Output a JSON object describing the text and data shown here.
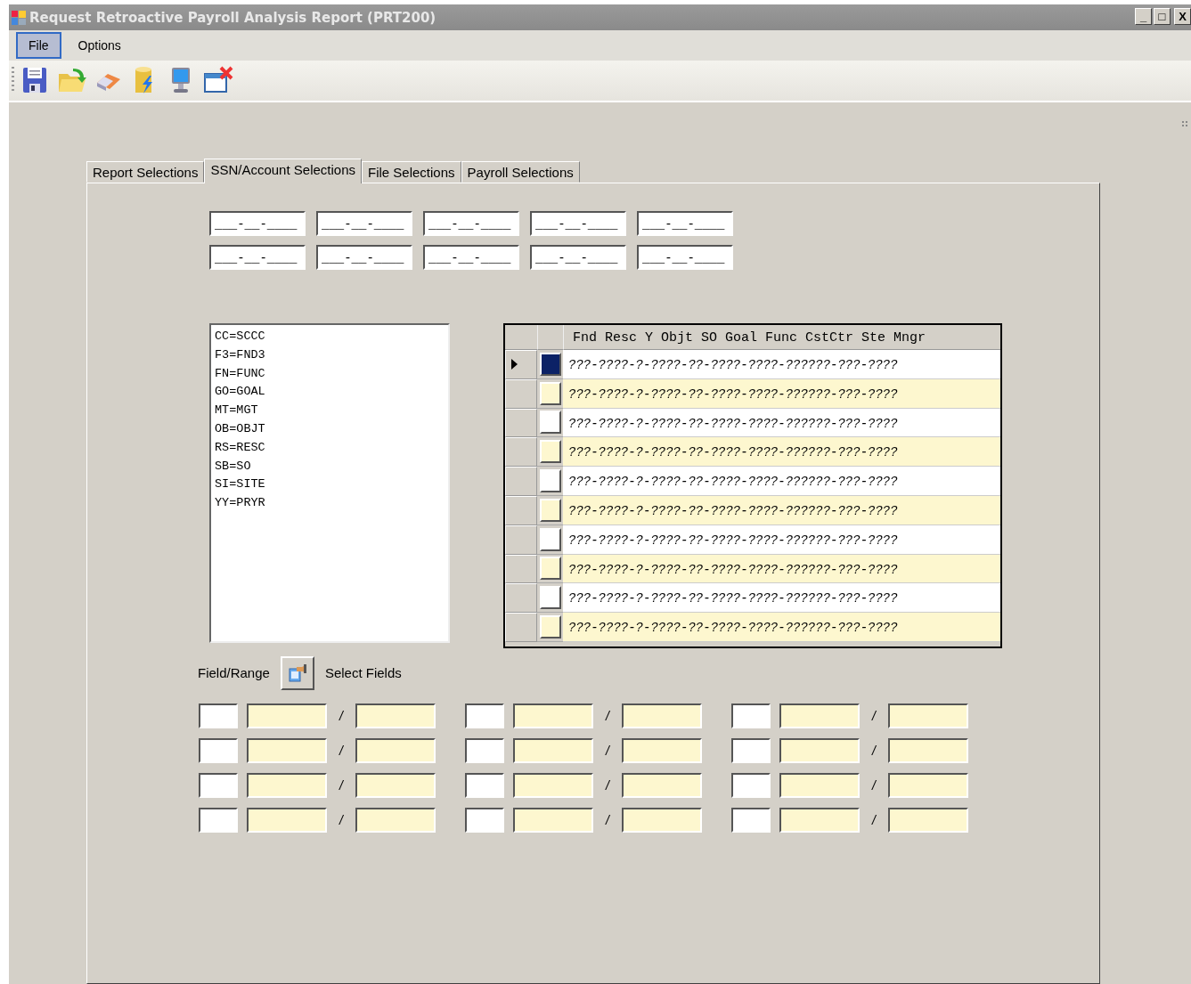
{
  "window": {
    "title": "Request Retroactive Payroll Analysis Report (PRT200)",
    "controls": [
      {
        "kind": "minimize",
        "label": "_"
      },
      {
        "kind": "maximize",
        "label": "□"
      },
      {
        "kind": "close",
        "label": "X"
      }
    ]
  },
  "menu": [
    {
      "label": "File",
      "selected": true
    },
    {
      "label": "Options",
      "selected": false
    }
  ],
  "toolbar": [
    {
      "kind": "save"
    },
    {
      "kind": "open"
    },
    {
      "kind": "eraser"
    },
    {
      "kind": "database"
    },
    {
      "kind": "computer"
    },
    {
      "kind": "close-window"
    }
  ],
  "tabs": [
    {
      "label": "Report Selections",
      "selected": false
    },
    {
      "label": "SSN/Account Selections",
      "selected": true
    },
    {
      "label": "File Selections",
      "selected": false
    },
    {
      "label": "Payroll Selections",
      "selected": false
    }
  ],
  "ssn_fields": [
    {
      "value": "___-__-____"
    },
    {
      "value": "___-__-____"
    },
    {
      "value": "___-__-____"
    },
    {
      "value": "___-__-____"
    },
    {
      "value": "___-__-____"
    },
    {
      "value": "___-__-____"
    },
    {
      "value": "___-__-____"
    },
    {
      "value": "___-__-____"
    },
    {
      "value": "___-__-____"
    },
    {
      "value": "___-__-____"
    }
  ],
  "code_list": [
    "CC=SCCC",
    "F3=FND3",
    "FN=FUNC",
    "GO=GOAL",
    "MT=MGT",
    "OB=OBJT",
    "RS=RESC",
    "SB=SO",
    "SI=SITE",
    "YY=PRYR"
  ],
  "account_grid": {
    "header": "Fnd Resc Y Objt SO Goal Func CstCtr Ste Mngr",
    "rows": [
      {
        "mask": "???-????-?-????-??-????-????-??????-???-????",
        "selected": true,
        "highlighted": false
      },
      {
        "mask": "???-????-?-????-??-????-????-??????-???-????",
        "selected": false,
        "highlighted": true
      },
      {
        "mask": "???-????-?-????-??-????-????-??????-???-????",
        "selected": false,
        "highlighted": false
      },
      {
        "mask": "???-????-?-????-??-????-????-??????-???-????",
        "selected": false,
        "highlighted": true
      },
      {
        "mask": "???-????-?-????-??-????-????-??????-???-????",
        "selected": false,
        "highlighted": false
      },
      {
        "mask": "???-????-?-????-??-????-????-??????-???-????",
        "selected": false,
        "highlighted": true
      },
      {
        "mask": "???-????-?-????-??-????-????-??????-???-????",
        "selected": false,
        "highlighted": false
      },
      {
        "mask": "???-????-?-????-??-????-????-??????-???-????",
        "selected": false,
        "highlighted": true
      },
      {
        "mask": "???-????-?-????-??-????-????-??????-???-????",
        "selected": false,
        "highlighted": false
      },
      {
        "mask": "???-????-?-????-??-????-????-??????-???-????",
        "selected": false,
        "highlighted": true
      }
    ]
  },
  "field_range": {
    "label": "Field/Range",
    "select_button": "Select Fields",
    "rows": [
      [
        {
          "separator": "/"
        },
        {
          "separator": "/"
        },
        {
          "separator": "/"
        }
      ],
      [
        {
          "separator": "/"
        },
        {
          "separator": "/"
        },
        {
          "separator": "/"
        }
      ],
      [
        {
          "separator": "/"
        },
        {
          "separator": "/"
        },
        {
          "separator": "/"
        }
      ],
      [
        {
          "separator": "/"
        },
        {
          "separator": "/"
        },
        {
          "separator": "/"
        }
      ]
    ]
  }
}
